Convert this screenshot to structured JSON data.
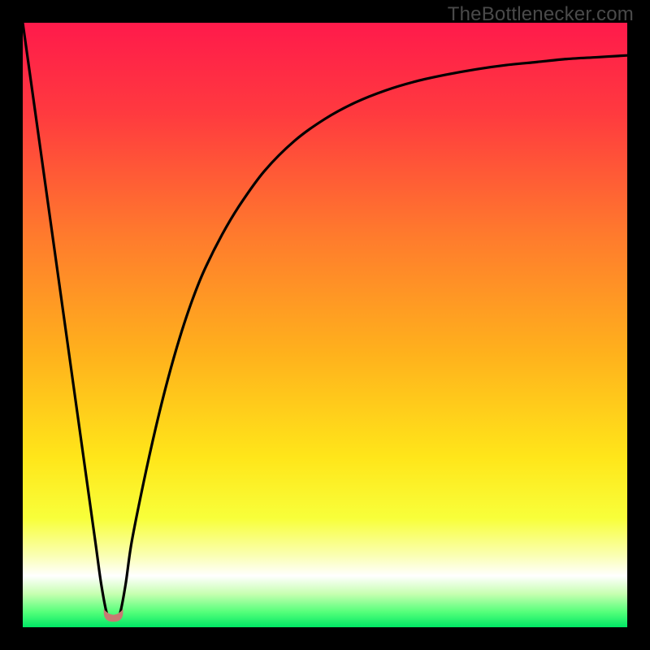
{
  "watermark": "TheBottlenecker.com",
  "chart_data": {
    "type": "line",
    "title": "",
    "xlabel": "",
    "ylabel": "",
    "xlim": [
      0,
      100
    ],
    "ylim": [
      0,
      100
    ],
    "x": [
      0,
      2,
      4,
      6,
      8,
      10,
      12,
      13,
      14,
      15,
      16,
      17,
      18,
      20,
      22,
      24,
      26,
      28,
      30,
      33,
      36,
      40,
      45,
      50,
      55,
      60,
      65,
      70,
      75,
      80,
      85,
      90,
      95,
      100
    ],
    "y": [
      100,
      85.7,
      71.4,
      57.1,
      42.8,
      28.5,
      14.2,
      7.0,
      2.0,
      1.5,
      2.0,
      7.0,
      14.0,
      24.0,
      33.0,
      41.0,
      48.0,
      54.0,
      59.0,
      65.0,
      70.0,
      75.5,
      80.5,
      84.1,
      86.8,
      88.8,
      90.3,
      91.4,
      92.3,
      93.0,
      93.5,
      94.0,
      94.3,
      94.6
    ],
    "minimum_marker": {
      "x_center": 15,
      "x_half_width": 1.6,
      "y": 1.5,
      "color": "#c77a72"
    },
    "gradient_stops": [
      {
        "offset": 0.0,
        "color": "#ff1a4b"
      },
      {
        "offset": 0.15,
        "color": "#ff3a3f"
      },
      {
        "offset": 0.35,
        "color": "#ff7a2d"
      },
      {
        "offset": 0.55,
        "color": "#ffb21c"
      },
      {
        "offset": 0.72,
        "color": "#ffe61a"
      },
      {
        "offset": 0.82,
        "color": "#f8ff3a"
      },
      {
        "offset": 0.88,
        "color": "#faffb0"
      },
      {
        "offset": 0.915,
        "color": "#ffffff"
      },
      {
        "offset": 0.945,
        "color": "#c6ffb0"
      },
      {
        "offset": 0.975,
        "color": "#54ff7a"
      },
      {
        "offset": 1.0,
        "color": "#00e765"
      }
    ]
  }
}
